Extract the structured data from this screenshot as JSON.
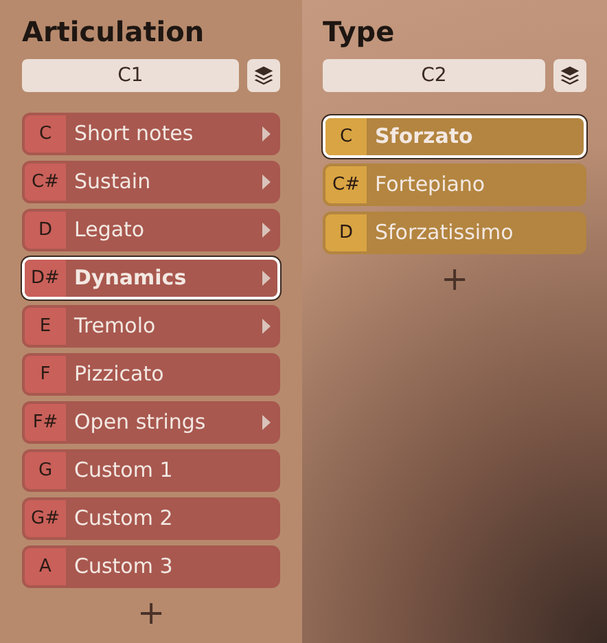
{
  "panels": [
    {
      "title": "Articulation",
      "field": "C1",
      "color": "#c9605a",
      "items": [
        {
          "key": "C",
          "label": "Short notes",
          "submenu": true,
          "selected": false
        },
        {
          "key": "C#",
          "label": "Sustain",
          "submenu": true,
          "selected": false
        },
        {
          "key": "D",
          "label": "Legato",
          "submenu": true,
          "selected": false
        },
        {
          "key": "D#",
          "label": "Dynamics",
          "submenu": true,
          "selected": true
        },
        {
          "key": "E",
          "label": "Tremolo",
          "submenu": true,
          "selected": false
        },
        {
          "key": "F",
          "label": "Pizzicato",
          "submenu": false,
          "selected": false
        },
        {
          "key": "F#",
          "label": "Open strings",
          "submenu": true,
          "selected": false
        },
        {
          "key": "G",
          "label": "Custom 1",
          "submenu": false,
          "selected": false
        },
        {
          "key": "G#",
          "label": "Custom 2",
          "submenu": false,
          "selected": false
        },
        {
          "key": "A",
          "label": "Custom 3",
          "submenu": false,
          "selected": false
        }
      ],
      "add": "+"
    },
    {
      "title": "Type",
      "field": "C2",
      "color": "#d9a443",
      "items": [
        {
          "key": "C",
          "label": "Sforzato",
          "submenu": false,
          "selected": true
        },
        {
          "key": "C#",
          "label": "Fortepiano",
          "submenu": false,
          "selected": false
        },
        {
          "key": "D",
          "label": "Sforzatissimo",
          "submenu": false,
          "selected": false
        }
      ],
      "add": "+"
    }
  ]
}
